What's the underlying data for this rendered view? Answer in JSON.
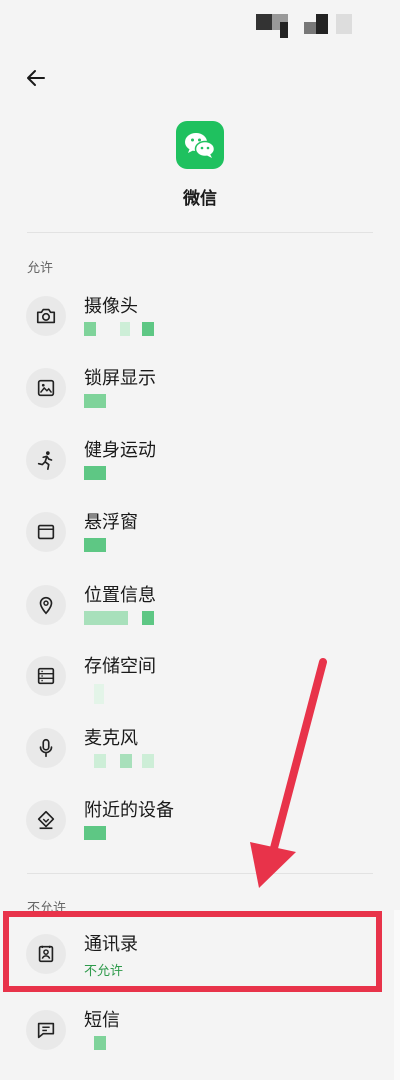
{
  "colors": {
    "accent": "#2e9a4b",
    "annotation": "#e8334a",
    "wechat_green": "#1fc15f"
  },
  "header": {
    "back_icon": "back-arrow-icon"
  },
  "app": {
    "name": "微信",
    "icon": "wechat-icon"
  },
  "sections": {
    "allowed": {
      "label": "允许",
      "items": [
        {
          "title": "摄像头",
          "icon": "camera-icon"
        },
        {
          "title": "锁屏显示",
          "icon": "image-icon"
        },
        {
          "title": "健身运动",
          "icon": "running-icon"
        },
        {
          "title": "悬浮窗",
          "icon": "window-icon"
        },
        {
          "title": "位置信息",
          "icon": "location-pin-icon"
        },
        {
          "title": "存储空间",
          "icon": "storage-icon"
        },
        {
          "title": "麦克风",
          "icon": "microphone-icon"
        },
        {
          "title": "附近的设备",
          "icon": "nearby-devices-icon"
        }
      ]
    },
    "denied": {
      "label": "不允许",
      "items": [
        {
          "title": "通讯录",
          "status": "不允许",
          "icon": "contacts-icon"
        },
        {
          "title": "短信",
          "icon": "sms-icon"
        }
      ]
    }
  }
}
